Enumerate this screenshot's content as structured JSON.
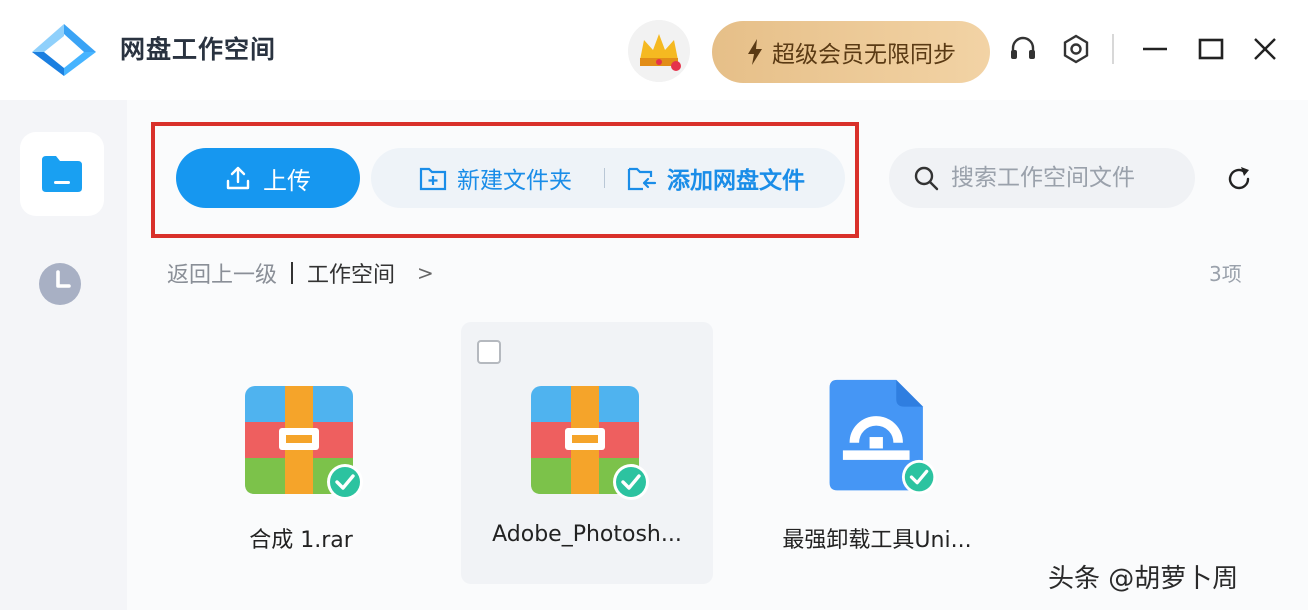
{
  "app": {
    "title": "网盘工作空间"
  },
  "titlebar": {
    "vip_button": "超级会员无限同步",
    "icons": [
      "headset-icon",
      "settings-icon",
      "minimize-icon",
      "maximize-icon",
      "close-icon"
    ]
  },
  "sidebar": {
    "items": [
      {
        "name": "files",
        "icon": "folder-icon",
        "active": true
      },
      {
        "name": "recent",
        "icon": "clock-icon",
        "active": false
      }
    ]
  },
  "toolbar": {
    "upload_label": "上传",
    "new_folder_label": "新建文件夹",
    "add_netdisk_label": "添加网盘文件",
    "search_placeholder": "搜索工作空间文件"
  },
  "breadcrumb": {
    "back_label": "返回上一级",
    "current": "工作空间",
    "chevron": ">"
  },
  "item_count": "3项",
  "files": [
    {
      "name": "合成 1.rar",
      "type": "archive",
      "synced": true
    },
    {
      "name": "Adobe_Photosh...",
      "type": "archive",
      "synced": true
    },
    {
      "name": "最强卸载工具Uni...",
      "type": "installer",
      "synced": true
    }
  ],
  "watermark": "头条 @胡萝卜周",
  "colors": {
    "accent": "#1697f0",
    "vip": "#e6bf88",
    "highlight": "#d9302a",
    "synced": "#2cc3a0"
  }
}
